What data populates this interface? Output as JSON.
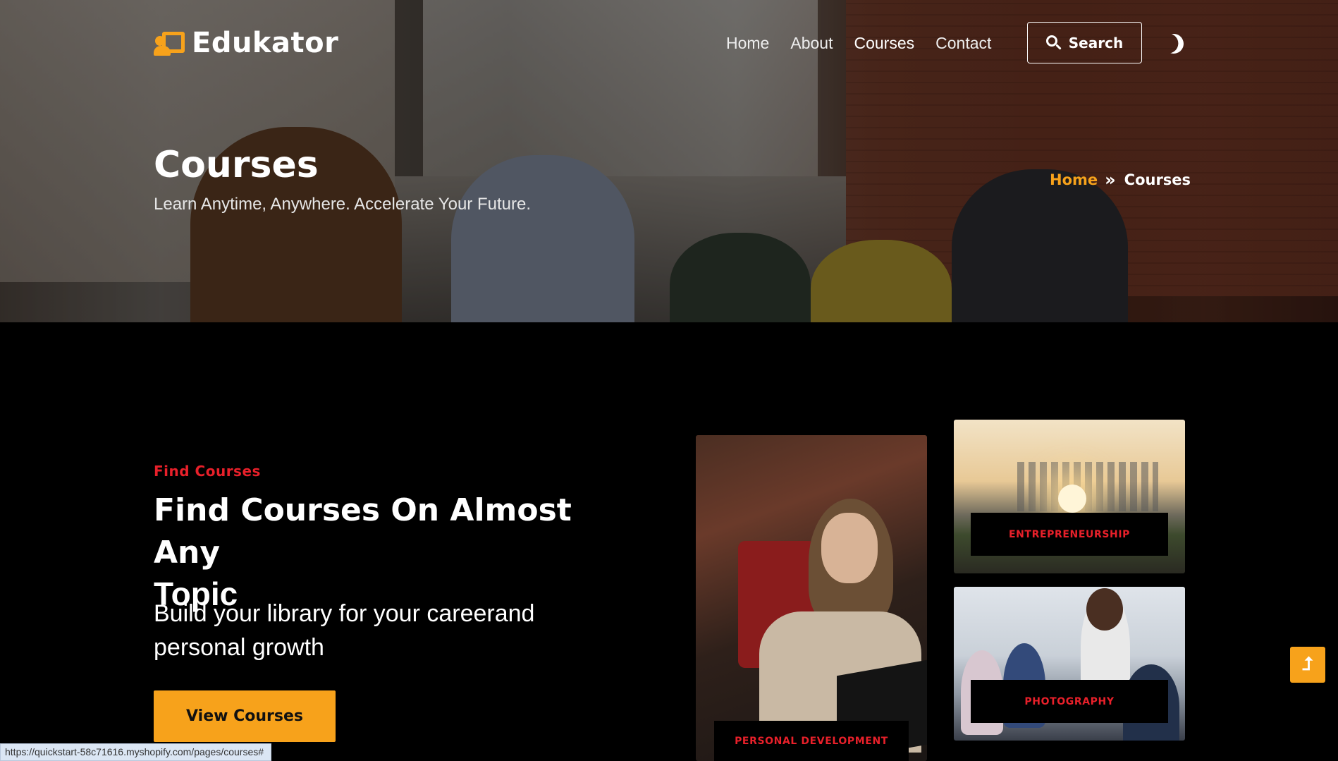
{
  "header": {
    "brand": "Edukator",
    "nav": [
      "Home",
      "About",
      "Courses",
      "Contact"
    ],
    "search_label": "Search"
  },
  "hero": {
    "title": "Courses",
    "subtitle": "Learn Anytime, Anywhere. Accelerate Your Future.",
    "breadcrumb": {
      "home": "Home",
      "separator": "»",
      "current": "Courses"
    }
  },
  "main": {
    "eyebrow": "Find Courses",
    "title_bold": "Find Courses On Almost Any",
    "title_rest": "Topic",
    "description": "Build your library for your careerand personal growth",
    "cta": "View Courses"
  },
  "cards": [
    {
      "label": "PERSONAL DEVELOPMENT"
    },
    {
      "label": "ENTREPRENEURSHIP"
    },
    {
      "label": "PHOTOGRAPHY"
    }
  ],
  "scroll_top_icon": "arrow-up",
  "status_bar": {
    "url": "https://quickstart-58c71616.myshopify.com/pages/courses#"
  },
  "colors": {
    "accent": "#f7a21b",
    "label_red": "#e8202a",
    "background": "#000000"
  },
  "icons": {
    "brand": "teacher-board-icon",
    "search": "search-icon",
    "theme": "moon-icon",
    "scroll": "arrow-up-icon"
  }
}
